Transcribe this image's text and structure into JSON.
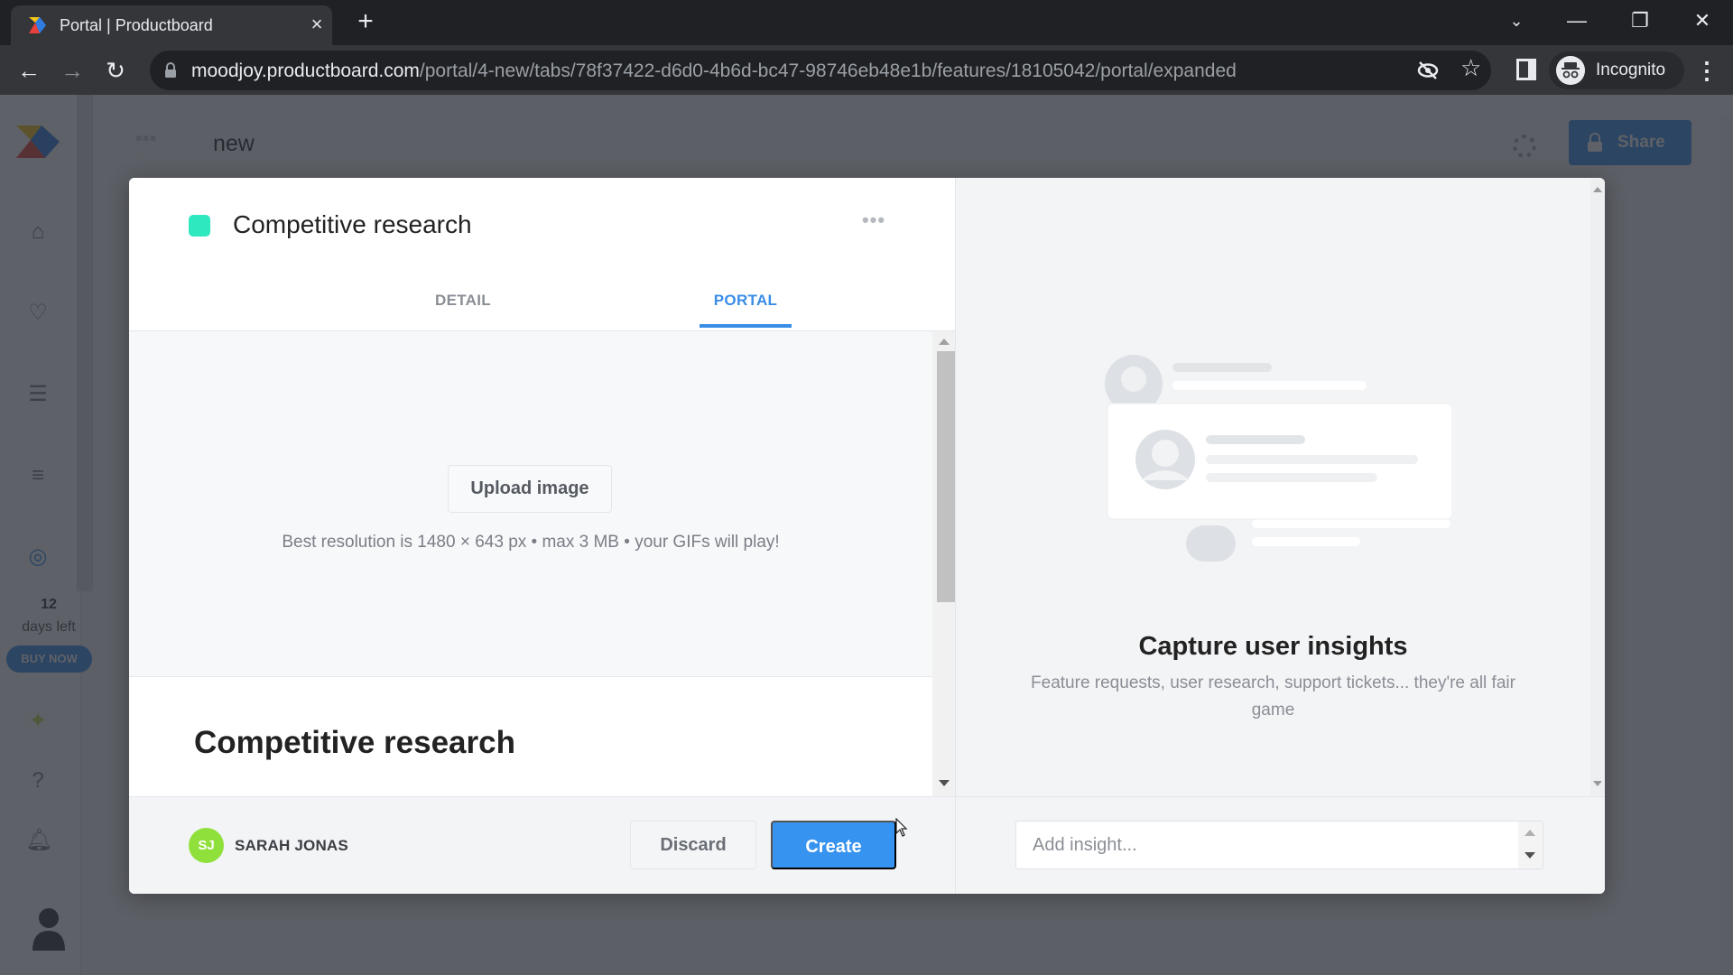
{
  "browser": {
    "tab_title": "Portal | Productboard",
    "url_host": "moodjoy.productboard.com",
    "url_path": "/portal/4-new/tabs/78f37422-d6d0-4b6d-bc47-98746eb48e1b/features/18105042/portal/expanded",
    "profile_label": "Incognito",
    "icons": {
      "close_tab": "×",
      "new_tab": "+",
      "back": "←",
      "forward": "→",
      "reload": "↻",
      "star": "☆",
      "menu": "⋮",
      "tab_search": "⌄",
      "minimize": "—",
      "restore": "❐",
      "close_window": "✕"
    }
  },
  "app": {
    "topbar": {
      "title": "new",
      "share_label": "Share"
    },
    "trial": {
      "days": "12",
      "label": "days left",
      "buy_label": "BUY NOW"
    }
  },
  "modal": {
    "feature": {
      "title": "Competitive research",
      "color": "#2ee8c0"
    },
    "more_label": "•••",
    "tabs": [
      {
        "label": "DETAIL",
        "active": false
      },
      {
        "label": "PORTAL",
        "active": true
      }
    ],
    "image_area": {
      "upload_label": "Upload image",
      "hint": "Best resolution is 1480 × 643 px • max 3 MB • your GIFs will play!"
    },
    "content_heading": "Competitive research",
    "footer": {
      "user_initials": "SJ",
      "user_name": "SARAH JONAS",
      "discard_label": "Discard",
      "create_label": "Create"
    },
    "insights": {
      "title": "Capture user insights",
      "description": "Feature requests, user research, support tickets... they're all fair game",
      "input_placeholder": "Add insight...",
      "input_value": ""
    }
  }
}
